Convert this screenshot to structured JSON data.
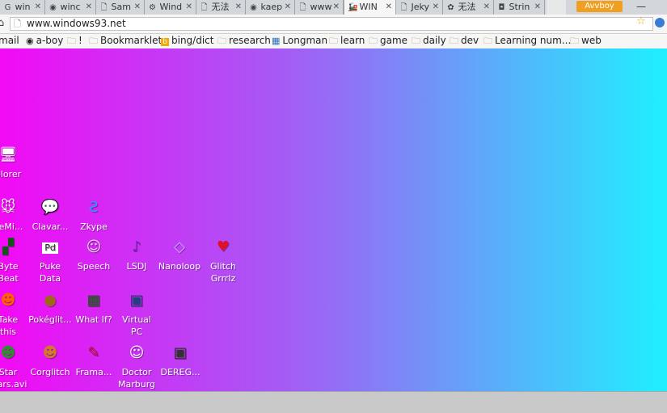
{
  "tabs": [
    {
      "label": "win",
      "icon": "G"
    },
    {
      "label": "winc",
      "icon": "◉"
    },
    {
      "label": "Sam",
      "icon": "🗋"
    },
    {
      "label": "Wind",
      "icon": "⚙"
    },
    {
      "label": "无法",
      "icon": "🗋"
    },
    {
      "label": "kaep",
      "icon": "◉"
    },
    {
      "label": "www",
      "icon": "🗋"
    },
    {
      "label": "WIN",
      "icon": "🚂"
    },
    {
      "label": "Jeky",
      "icon": "🗋"
    },
    {
      "label": "无法",
      "icon": "✿"
    },
    {
      "label": "Strin",
      "icon": "◘"
    }
  ],
  "profile_label": "Avvboy",
  "minimize_glyph": "—",
  "address": {
    "url": "www.windows93.net"
  },
  "bookmarks": [
    {
      "label": "mail",
      "icon": ""
    },
    {
      "label": "a-boy",
      "icon": "◉"
    },
    {
      "label": "!",
      "icon": "🗀"
    },
    {
      "label": "Bookmarklet",
      "icon": "🗀"
    },
    {
      "label": "bing/dict",
      "icon": "b"
    },
    {
      "label": "research",
      "icon": "🗀"
    },
    {
      "label": "Longman",
      "icon": "▦"
    },
    {
      "label": "learn",
      "icon": "🗀"
    },
    {
      "label": "game",
      "icon": "🗀"
    },
    {
      "label": "daily",
      "icon": "🗀"
    },
    {
      "label": "dev",
      "icon": "🗀"
    },
    {
      "label": "Learning num...",
      "icon": "🗀"
    },
    {
      "label": "web",
      "icon": "🗀"
    }
  ],
  "desktop_icons": [
    {
      "label": "plorer",
      "glyph": "🖥"
    },
    {
      "label": "deMi...",
      "glyph": "🐭"
    },
    {
      "label": "Clavar...",
      "glyph": "💬"
    },
    {
      "label": "Zkype",
      "glyph": "Ƨ"
    },
    {
      "label": "Byte\nBeat",
      "glyph": "▞"
    },
    {
      "label": "Puke\nData",
      "glyph": "Pd"
    },
    {
      "label": "Speech",
      "glyph": "☺"
    },
    {
      "label": "LSDJ",
      "glyph": "♪"
    },
    {
      "label": "Nanoloop",
      "glyph": "◇"
    },
    {
      "label": "Glitch\nGrrrlz",
      "glyph": "♥"
    },
    {
      "label": "Take\nthis",
      "glyph": "☻"
    },
    {
      "label": "Pokéglit...",
      "glyph": "●"
    },
    {
      "label": "What If?",
      "glyph": "▦"
    },
    {
      "label": "Virtual\nPC",
      "glyph": "▣"
    },
    {
      "label": "Star\nWars.avi",
      "glyph": "☻"
    },
    {
      "label": "Corglitch",
      "glyph": "☻"
    },
    {
      "label": "Frama...",
      "glyph": "✎"
    },
    {
      "label": "Doctor\nMarburg",
      "glyph": "☺"
    },
    {
      "label": "DEREG...",
      "glyph": "▣"
    }
  ],
  "colors": {
    "gradient_left": "#f20af5",
    "gradient_right": "#1ef0ff",
    "profile": "#f0a020"
  }
}
